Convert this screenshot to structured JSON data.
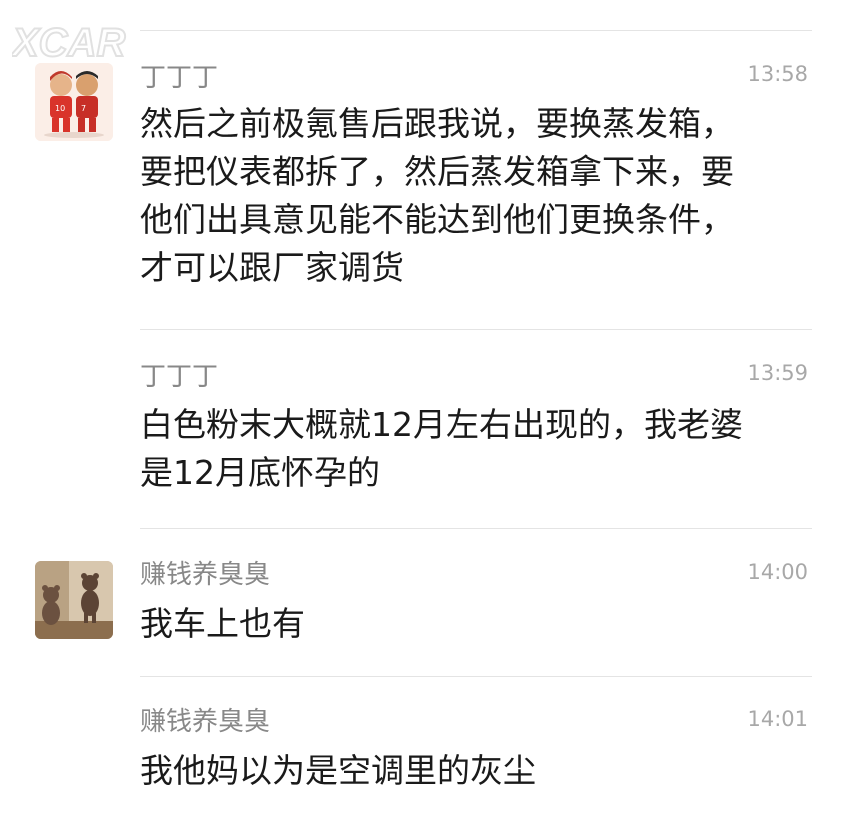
{
  "watermark": {
    "label": "XCAR 爱卡",
    "icon": "xcar-watermark-icon"
  },
  "messages": [
    {
      "sender": "丁丁丁",
      "time": "13:58",
      "avatar": "basketball-duo-avatar",
      "lines": [
        "然后之前极氪售后跟我说，要换蒸发箱，",
        "要把仪表都拆了，然后蒸发箱拿下来，要",
        "他们出具意见能不能达到他们更换条件，",
        "才可以跟厂家调货"
      ]
    },
    {
      "sender": "丁丁丁",
      "time": "13:59",
      "avatar": null,
      "lines": [
        "白色粉末大概就12月左右出现的，我老婆",
        "是12月底怀孕的"
      ]
    },
    {
      "sender": "赚钱养臭臭",
      "time": "14:00",
      "avatar": "teddy-bear-avatar",
      "lines": [
        "我车上也有"
      ]
    },
    {
      "sender": "赚钱养臭臭",
      "time": "14:01",
      "avatar": null,
      "lines": [
        "我他妈以为是空调里的灰尘"
      ]
    }
  ]
}
